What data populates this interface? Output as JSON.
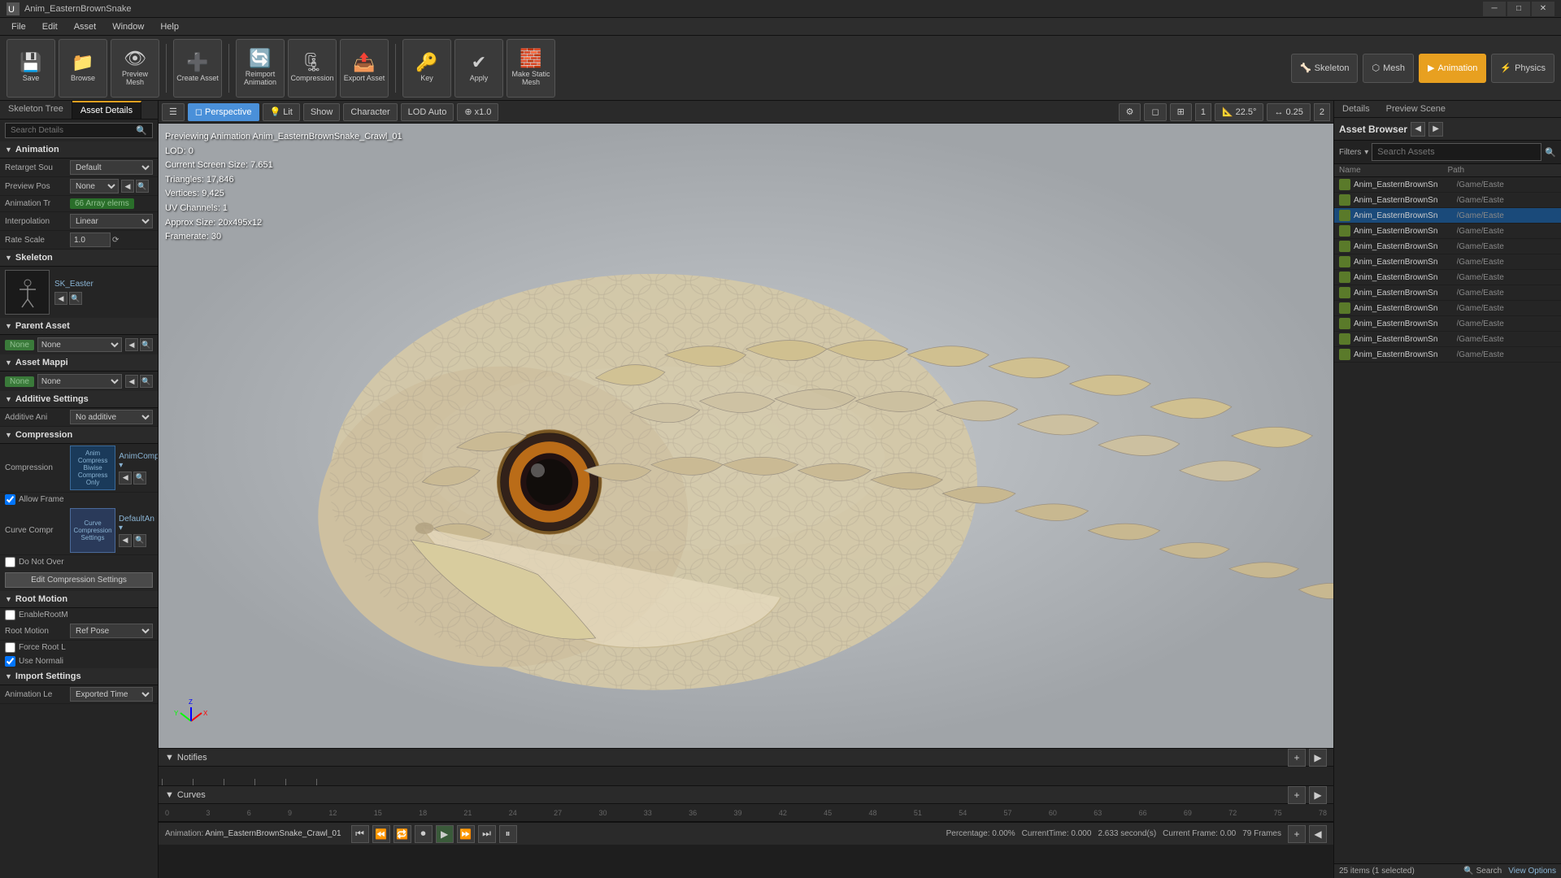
{
  "titlebar": {
    "title": "Anim_EasternBrownSnake",
    "minimize": "─",
    "maximize": "□",
    "close": "✕"
  },
  "menubar": {
    "items": [
      "File",
      "Edit",
      "Asset",
      "Window",
      "Help"
    ]
  },
  "toolbar": {
    "buttons": [
      {
        "id": "save",
        "icon": "💾",
        "label": "Save"
      },
      {
        "id": "browse",
        "icon": "📁",
        "label": "Browse"
      },
      {
        "id": "preview-mesh",
        "icon": "👁",
        "label": "Preview Mesh"
      },
      {
        "id": "create-asset",
        "icon": "➕",
        "label": "Create Asset"
      },
      {
        "id": "reimport",
        "icon": "🔄",
        "label": "Reimport Animation"
      },
      {
        "id": "compression",
        "icon": "🗜",
        "label": "Compression"
      },
      {
        "id": "export-asset",
        "icon": "📤",
        "label": "Export Asset"
      },
      {
        "id": "key",
        "icon": "🔑",
        "label": "Key"
      },
      {
        "id": "apply",
        "icon": "✔",
        "label": "Apply"
      },
      {
        "id": "make-static",
        "icon": "🧱",
        "label": "Make Static Mesh"
      }
    ],
    "view_buttons": [
      {
        "id": "skeleton",
        "label": "Skeleton",
        "active": false
      },
      {
        "id": "mesh",
        "label": "Mesh",
        "active": false
      },
      {
        "id": "animation",
        "label": "Animation",
        "active": true
      },
      {
        "id": "physics",
        "label": "Physics",
        "active": false
      }
    ]
  },
  "left_panel": {
    "tabs": [
      "Skeleton Tree",
      "Asset Details"
    ],
    "active_tab": "Asset Details",
    "search_placeholder": "Search Details",
    "sections": {
      "animation": {
        "title": "Animation",
        "retarget_source": {
          "label": "Retarget Sou",
          "value": "Default"
        },
        "preview_pose": {
          "label": "Preview Pos",
          "value": "None"
        },
        "animation_track": {
          "label": "Animation Tr",
          "value": "66 Array elems"
        },
        "interpolation": {
          "label": "Interpolation",
          "value": "Linear"
        },
        "rate_scale": {
          "label": "Rate Scale",
          "value": "1.0"
        }
      },
      "skeleton": {
        "title": "Skeleton",
        "name": "SK_Easter",
        "skeleton_label": "Skeleton"
      },
      "parent_asset": {
        "title": "Parent Asset",
        "value": "None"
      },
      "asset_mapping": {
        "title": "Asset Mappi",
        "value": "None"
      },
      "additive_settings": {
        "title": "Additive Settings",
        "additive_anim": {
          "label": "Additive Ani",
          "value": "No additive"
        }
      },
      "compression": {
        "title": "Compression",
        "compression_label": "Compression",
        "anim_compress_text": "Anim Compress Biwise Compress Only",
        "anim_compress_badge": "AnimComp",
        "allow_frame": {
          "label": "Allow Frame",
          "checked": true
        },
        "curve_compression": {
          "label": "Curve Compr",
          "text": "Curve Compression Settings",
          "badge": "DefaultAn"
        },
        "do_not_override": {
          "label": "Do Not Over",
          "checked": false
        },
        "edit_btn": "Edit Compression Settings"
      },
      "root_motion": {
        "title": "Root Motion",
        "enable_root_motion": {
          "label": "EnableRootM",
          "checked": false
        },
        "root_motion_val": {
          "label": "Root Motion",
          "value": "Ref Pose"
        },
        "force_root_lock": {
          "label": "Force Root L",
          "checked": false
        },
        "use_normalized": {
          "label": "Use Normali",
          "checked": true
        }
      },
      "import_settings": {
        "title": "Import Settings",
        "animation_length": {
          "label": "Animation Le",
          "value": "Exported Time"
        }
      }
    }
  },
  "viewport": {
    "toolbar": {
      "perspective": "Perspective",
      "lit": "Lit",
      "show": "Show",
      "character": "Character",
      "lod_auto": "LOD Auto",
      "zoom": "x1.0",
      "angle": "22.5°",
      "scale": "0.25",
      "lod_num": "2"
    },
    "preview_info": {
      "line1": "Previewing Animation Anim_EasternBrownSnake_Crawl_01",
      "line2": "LOD: 0",
      "line3": "Current Screen Size: 7.651",
      "line4": "Triangles: 17,846",
      "line5": "Vertices: 9,425",
      "line6": "UV Channels: 1",
      "line7": "Approx Size: 20x495x12",
      "line8": "Framerate: 30"
    }
  },
  "timeline": {
    "sections": [
      "Notifies",
      "Curves"
    ],
    "animation_name": "Anim_EasternBrownSnake_Crawl_01",
    "status": {
      "percentage": "Percentage: 0.00%",
      "current_time": "CurrentTime: 0.000",
      "duration": "2.633 second(s)",
      "current_frame": "Current Frame: 0.00",
      "total_frames": "79 Frames"
    },
    "ruler_ticks": [
      "0",
      "3",
      "6",
      "9",
      "12",
      "15",
      "18",
      "21",
      "24",
      "27",
      "30",
      "33",
      "36",
      "39",
      "42",
      "45",
      "48",
      "51",
      "54",
      "57",
      "60",
      "63",
      "66",
      "69",
      "72",
      "75",
      "78"
    ],
    "playback_controls": [
      "⏮",
      "⏪",
      "⏩",
      "⏺",
      "▶",
      "⏩",
      "⏭",
      "⏸"
    ]
  },
  "right_panel": {
    "tabs": [
      "Details",
      "Preview Scene"
    ],
    "asset_browser": {
      "title": "Asset Browser",
      "filters_label": "Filters",
      "search_placeholder": "Search Assets",
      "columns": [
        "Name",
        "Path"
      ],
      "items": [
        {
          "name": "Anim_EasternBrownSn",
          "path": "/Game/Easte",
          "selected": false
        },
        {
          "name": "Anim_EasternBrownSn",
          "path": "/Game/Easte",
          "selected": false
        },
        {
          "name": "Anim_EasternBrownSn",
          "path": "/Game/Easte",
          "selected": true
        },
        {
          "name": "Anim_EasternBrownSn",
          "path": "/Game/Easte",
          "selected": false
        },
        {
          "name": "Anim_EasternBrownSn",
          "path": "/Game/Easte",
          "selected": false
        },
        {
          "name": "Anim_EasternBrownSn",
          "path": "/Game/Easte",
          "selected": false
        },
        {
          "name": "Anim_EasternBrownSn",
          "path": "/Game/Easte",
          "selected": false
        },
        {
          "name": "Anim_EasternBrownSn",
          "path": "/Game/Easte",
          "selected": false
        },
        {
          "name": "Anim_EasternBrownSn",
          "path": "/Game/Easte",
          "selected": false
        },
        {
          "name": "Anim_EasternBrownSn",
          "path": "/Game/Easte",
          "selected": false
        },
        {
          "name": "Anim_EasternBrownSn",
          "path": "/Game/Easte",
          "selected": false
        },
        {
          "name": "Anim_EasternBrownSn",
          "path": "/Game/Easte",
          "selected": false
        }
      ],
      "footer": "25 items (1 selected)",
      "view_options": "View Options",
      "search_label": "Search"
    }
  },
  "colors": {
    "accent": "#e8a020",
    "active_bg": "#1a4a7a",
    "selected_asset": "#1a4a7a"
  }
}
